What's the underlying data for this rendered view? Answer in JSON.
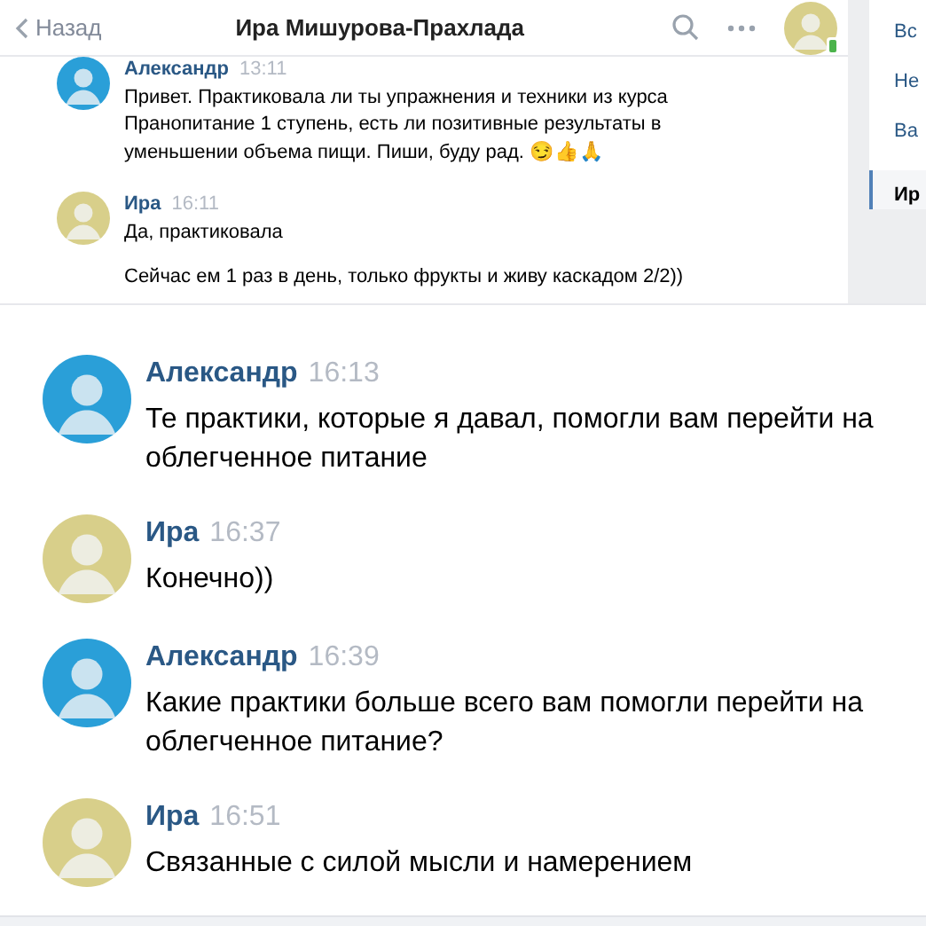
{
  "header": {
    "back": "Назад",
    "title": "Ира Мишурова-Прахлада",
    "online_mobile": true
  },
  "sidebar": {
    "items": [
      {
        "label": "Вс",
        "selected": false
      },
      {
        "label": "Не",
        "selected": false
      },
      {
        "label": "Ва",
        "selected": false
      },
      {
        "label": "Ир",
        "selected": true
      }
    ]
  },
  "top_messages": [
    {
      "author": "Александр",
      "time": "13:11",
      "color": "#2a9fd8",
      "paragraphs": [
        "Привет. Практиковала ли ты упражнения и техники из курса Пранопитание 1 ступень, есть ли позитивные результаты в уменьшении объема пищи. Пиши, буду рад. 😏👍🙏"
      ]
    },
    {
      "author": "Ира",
      "time": "16:11",
      "color": "#d8cf8a",
      "paragraphs": [
        "Да, практиковала",
        "Сейчас ем 1 раз в день, только фрукты и живу каскадом 2/2))"
      ]
    }
  ],
  "messages": [
    {
      "author": "Александр",
      "time": "16:13",
      "color": "#2a9fd8",
      "text": "Те практики, которые я давал, помогли вам перейти на облегченное питание"
    },
    {
      "author": "Ира",
      "time": "16:37",
      "color": "#d8cf8a",
      "text": "Конечно))"
    },
    {
      "author": "Александр",
      "time": "16:39",
      "color": "#2a9fd8",
      "text": "Какие практики больше всего вам помогли перейти на облегченное питание?"
    },
    {
      "author": "Ира",
      "time": "16:51",
      "color": "#d8cf8a",
      "text": "Связанные с силой мысли и намерением"
    }
  ]
}
